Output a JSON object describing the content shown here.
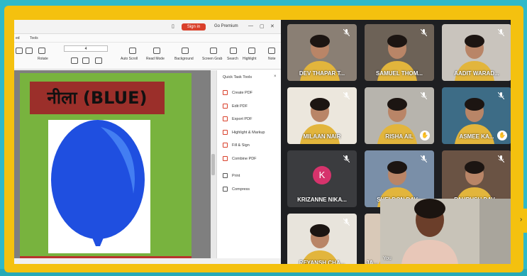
{
  "pdf_app": {
    "signin_label": "Sign in",
    "premium_label": "Go Premium",
    "menu": [
      "ed",
      "Tools"
    ],
    "page_value": "4",
    "toolbar": [
      "Rotate",
      "Auto Scroll",
      "Read Mode",
      "Background",
      "Screen Grab",
      "Search",
      "Highlight",
      "Note"
    ]
  },
  "slide": {
    "title": "नीला (BLUE)",
    "balloon_color": "#1f4fe0"
  },
  "quick_tools": {
    "title": "Quick Task Tools",
    "close": "×",
    "items": [
      "Create PDF",
      "Edit PDF",
      "Export PDF",
      "Highlight & Markup",
      "Fill & Sign",
      "Combine PDF",
      "Print",
      "Compress"
    ]
  },
  "participants": [
    {
      "name": "DEV THAPAR T...",
      "bg": "#8a7f74"
    },
    {
      "name": "SAMUEL THOM...",
      "bg": "#6d6257"
    },
    {
      "name": "AADIT WARAD...",
      "bg": "#c9c4bd"
    },
    {
      "name": "MILAAN NAIR",
      "bg": "#ece7dd"
    },
    {
      "name": "RISHA AIL",
      "bg": "#b7b4ad"
    },
    {
      "name": "ASMEE KA...",
      "bg": "#3d6c86"
    },
    {
      "name": "KRIZANNE NIKA...",
      "bg": "#3b3c3f"
    },
    {
      "name": "SHELDON DAV...",
      "bg": "#7a8fa8"
    },
    {
      "name": "PAURUSH DAV...",
      "bg": "#6a5344"
    },
    {
      "name": "REYANSH CHA...",
      "bg": "#e8e4dc"
    },
    {
      "name": "JA...",
      "bg": "#d9c9b8"
    }
  ],
  "avatar_letter": "K",
  "self_view": {
    "name": "You"
  },
  "hand_icon": "✋",
  "colors": {
    "frame": "#f4c10f",
    "background": "#2fb9c9",
    "slide_green": "#78b33e",
    "title_red": "#9b2f2a"
  }
}
